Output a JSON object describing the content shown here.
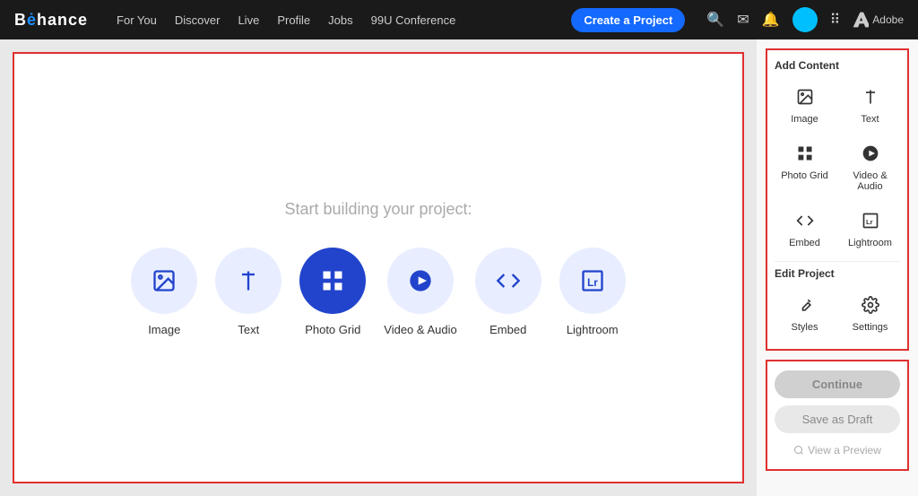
{
  "navbar": {
    "brand": "Behance",
    "nav_items": [
      {
        "label": "For You"
      },
      {
        "label": "Discover"
      },
      {
        "label": "Live"
      },
      {
        "label": "Profile"
      },
      {
        "label": "Jobs"
      },
      {
        "label": "99U Conference"
      }
    ],
    "create_button": "Create a Project",
    "adobe_label": "Adobe"
  },
  "canvas": {
    "prompt": "Start building your project:",
    "content_types": [
      {
        "label": "Image",
        "icon": "image-icon"
      },
      {
        "label": "Text",
        "icon": "text-icon"
      },
      {
        "label": "Photo Grid",
        "icon": "grid-icon"
      },
      {
        "label": "Video & Audio",
        "icon": "video-icon"
      },
      {
        "label": "Embed",
        "icon": "embed-icon"
      },
      {
        "label": "Lightroom",
        "icon": "lightroom-icon"
      }
    ]
  },
  "sidebar": {
    "add_content_title": "Add Content",
    "add_content_items": [
      {
        "label": "Image",
        "icon": "image-icon"
      },
      {
        "label": "Text",
        "icon": "text-icon"
      },
      {
        "label": "Photo Grid",
        "icon": "grid-icon"
      },
      {
        "label": "Video & Audio",
        "icon": "video-icon"
      },
      {
        "label": "Embed",
        "icon": "embed-icon"
      },
      {
        "label": "Lightroom",
        "icon": "lightroom-icon"
      }
    ],
    "edit_project_title": "Edit Project",
    "edit_items": [
      {
        "label": "Styles",
        "icon": "styles-icon"
      },
      {
        "label": "Settings",
        "icon": "settings-icon"
      }
    ]
  },
  "actions": {
    "continue_label": "Continue",
    "draft_label": "Save as Draft",
    "preview_label": "View a Preview"
  }
}
